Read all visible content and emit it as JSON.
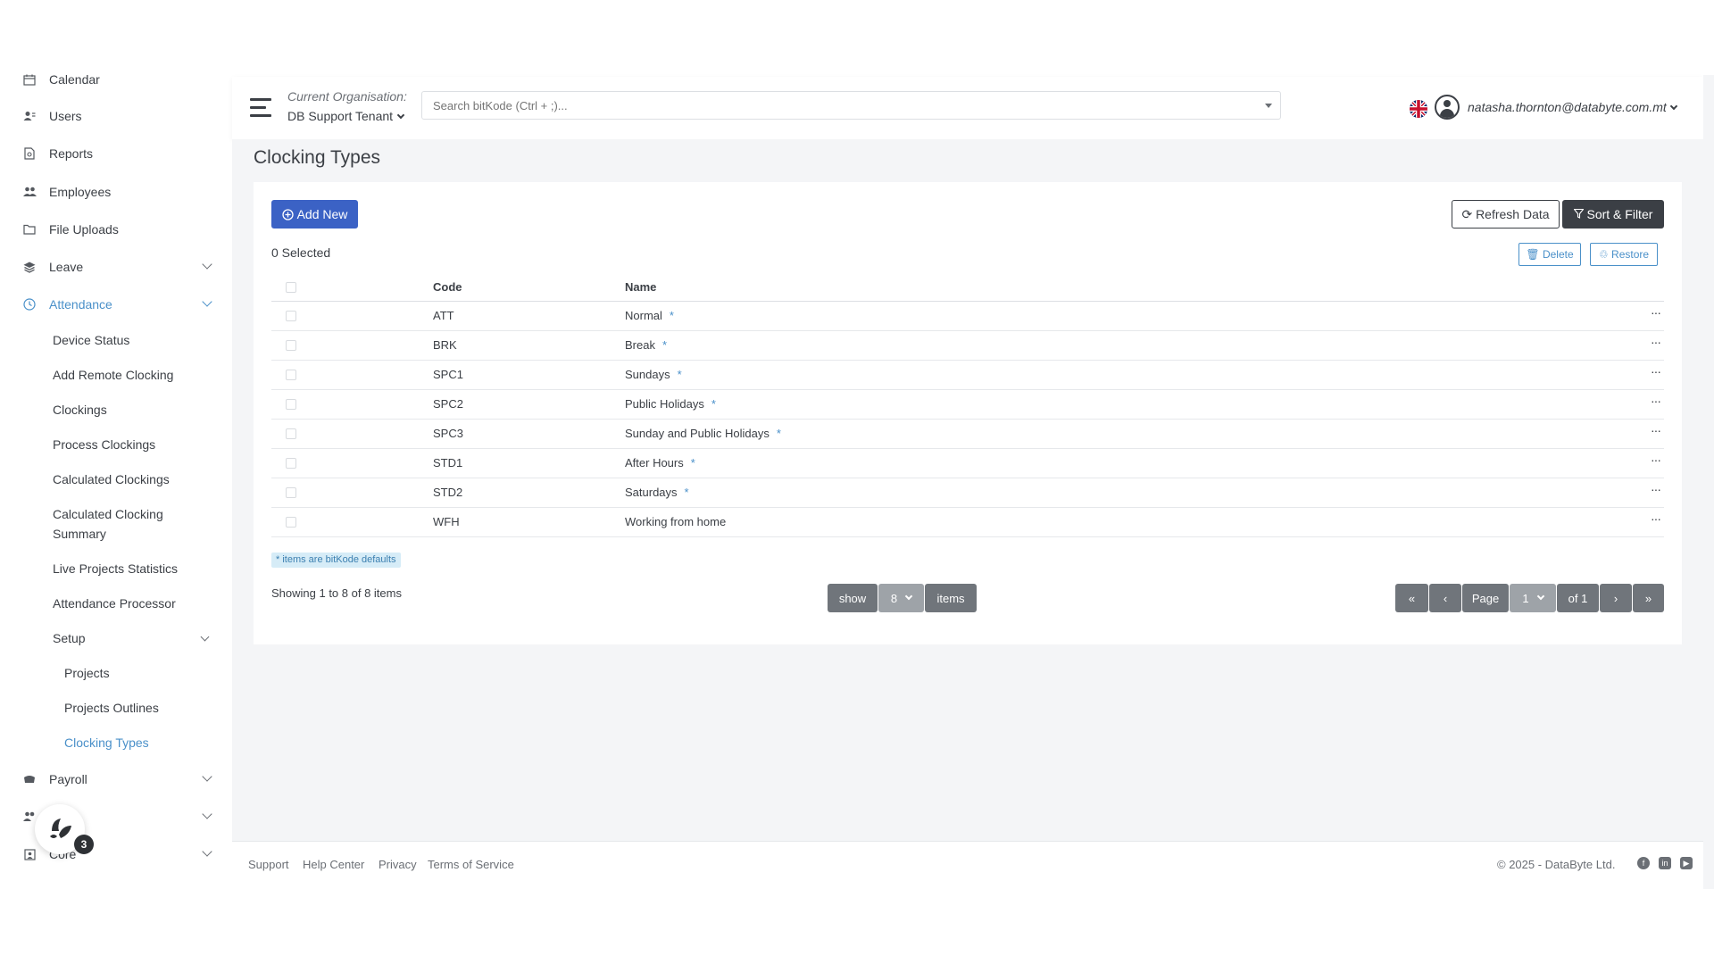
{
  "sidebar": {
    "items": [
      {
        "label": "Calendar",
        "icon": "calendar-icon"
      },
      {
        "label": "Users",
        "icon": "users-icon"
      },
      {
        "label": "Reports",
        "icon": "report-icon"
      },
      {
        "label": "Employees",
        "icon": "employees-icon"
      },
      {
        "label": "File Uploads",
        "icon": "folder-icon"
      },
      {
        "label": "Leave",
        "icon": "layers-icon"
      },
      {
        "label": "Attendance",
        "icon": "clock-icon"
      }
    ],
    "attendance_sub": [
      {
        "label": "Device Status"
      },
      {
        "label": "Add Remote Clocking"
      },
      {
        "label": "Clockings"
      },
      {
        "label": "Process Clockings"
      },
      {
        "label": "Calculated Clockings"
      },
      {
        "label": "Calculated Clocking Summary"
      },
      {
        "label": "Live Projects Statistics"
      },
      {
        "label": "Attendance Processor"
      },
      {
        "label": "Setup"
      }
    ],
    "setup_sub": [
      {
        "label": "Projects"
      },
      {
        "label": "Projects Outlines"
      },
      {
        "label": "Clocking Types"
      }
    ],
    "bottom_items": [
      {
        "label": "Payroll",
        "icon": "payroll-icon"
      },
      {
        "label": "Core",
        "icon": "core-icon"
      }
    ],
    "accent_color": "#4a90c9"
  },
  "header": {
    "org_label": "Current Organisation:",
    "org_value": "DB Support Tenant",
    "search_placeholder": "Search bitKode (Ctrl + ;)...",
    "user_email": "natasha.thornton@databyte.com.mt"
  },
  "page": {
    "title": "Clocking Types",
    "add_new": "Add New",
    "refresh": "Refresh Data",
    "sort_filter": "Sort & Filter",
    "selected": "0 Selected",
    "delete": "Delete",
    "restore": "Restore",
    "columns": {
      "code": "Code",
      "name": "Name"
    },
    "rows": [
      {
        "code": "ATT",
        "name": "Normal",
        "default": "*"
      },
      {
        "code": "BRK",
        "name": "Break",
        "default": "*"
      },
      {
        "code": "SPC1",
        "name": "Sundays",
        "default": "*"
      },
      {
        "code": "SPC2",
        "name": "Public Holidays",
        "default": "*"
      },
      {
        "code": "SPC3",
        "name": "Sunday and Public Holidays",
        "default": "*"
      },
      {
        "code": "STD1",
        "name": "After Hours",
        "default": "*"
      },
      {
        "code": "STD2",
        "name": "Saturdays",
        "default": "*"
      },
      {
        "code": "WFH",
        "name": "Working from home",
        "default": ""
      }
    ],
    "row_menu": "···",
    "defaults_note": "* items are bitKode defaults",
    "showing": "Showing 1 to 8 of 8 items",
    "pager": {
      "show": "show",
      "per_page": "8",
      "items": "items",
      "page": "Page",
      "current_page": "1",
      "of": "of 1"
    },
    "primary_color": "#3b62c5"
  },
  "footer": {
    "links": [
      "Support",
      "Help Center",
      "Privacy",
      "Terms of Service"
    ],
    "copyright": "© 2025 - DataByte Ltd."
  },
  "widget": {
    "badge": "3"
  }
}
